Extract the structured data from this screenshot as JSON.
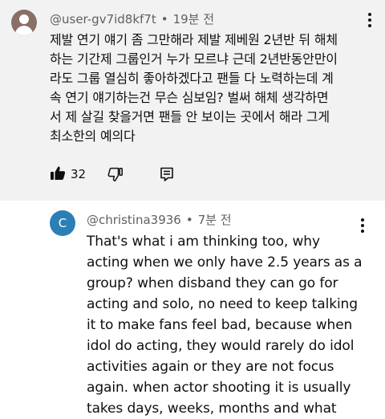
{
  "comments": [
    {
      "author": "@user-gv7id8kf7t",
      "separator": "•",
      "timestamp": "19분 전",
      "text_lines": [
        "제발 연기 얘기 좀 그만해라 제발 제베원 2년반 뒤 해체",
        "하는 기간제 그룹인거 누가 모르냐 근데 2년반동안만이",
        "라도 그룹 열심히 좋아하겠다고 팬들 다 노력하는데 계",
        "속 연기 얘기하는건 무슨 심보임? 벌써 해체 생각하면",
        "서 제 살길 찾을거면 팬들 안 보이는 곳에서 해라 그게",
        "최소한의 예의다"
      ],
      "like_count": "32",
      "icons": {
        "avatar": "default-user-avatar",
        "more": "more-vert-icon",
        "like": "thumbs-up-icon",
        "dislike": "thumbs-down-icon",
        "reply": "reply-comment-icon"
      }
    },
    {
      "author": "@christina3936",
      "separator": "•",
      "timestamp": "7분 전",
      "avatar_letter": "C",
      "avatar_color": "#2a7fb5",
      "text_lines": [
        "That's what i am thinking too, why",
        "acting when we only have 2.5 years as a",
        "group? when disband they can go for",
        "acting and solo, no need to keep talking",
        "it to make fans feel bad, because when",
        "idol do acting, they would rarely do idol",
        "activities again or they are not focus",
        "again. when actor shooting it is usually",
        "takes days, weeks, months and what"
      ],
      "icons": {
        "more": "more-vert-icon"
      }
    }
  ]
}
